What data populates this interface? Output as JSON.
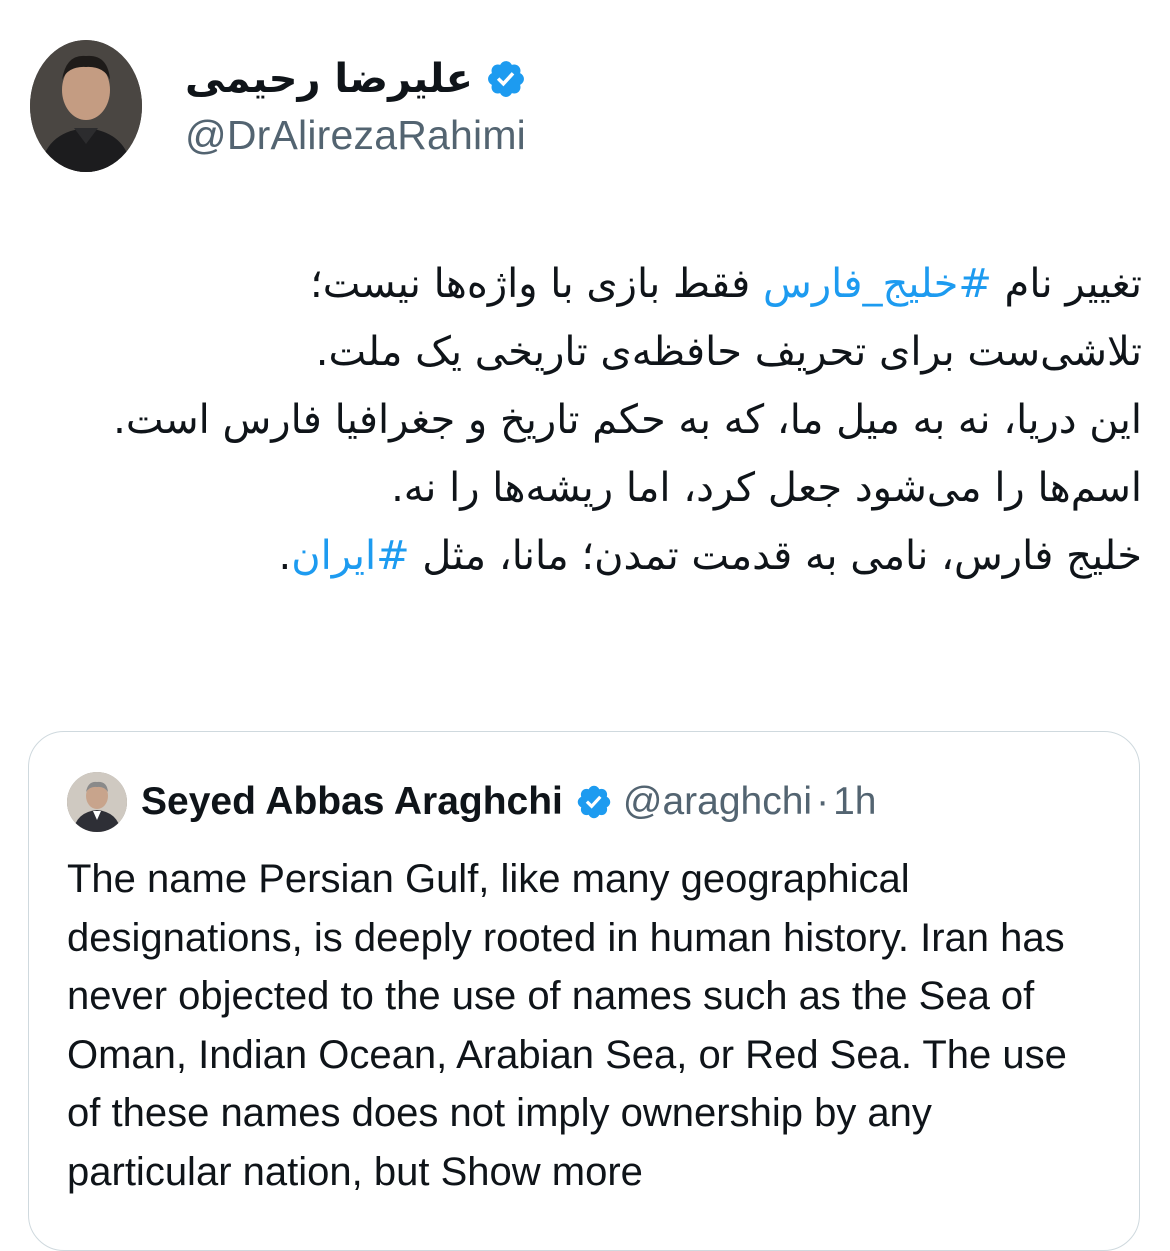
{
  "author": {
    "display_name": "علیرضا رحیمی",
    "handle": "@DrAlirezaRahimi",
    "verified_icon": "verified-badge-icon",
    "verified_color": "#1d9bf0"
  },
  "tweet": {
    "line1": {
      "pre": "تغییر نام ",
      "hashtag": "#خلیج_فارس",
      "post": " فقط بازی با واژه‌ها نیست؛"
    },
    "line2": "تلاشی‌ست برای تحریف حافظه‌ی تاریخی یک ملت.",
    "line3": "این دریا، نه به میل ما، که به حکم تاریخ و جغرافیا فارس است.",
    "line4": "اسم‌ها را می‌شود جعل کرد، اما ریشه‌ها را نه.",
    "line5": {
      "pre": "خلیج فارس، نامی به قدمت تمدن؛ مانا، مثل ",
      "hashtag": "#ایران",
      "post": "."
    },
    "hashtag_color": "#1d9bf0"
  },
  "quote": {
    "name": "Seyed Abbas Araghchi",
    "handle": "@araghchi",
    "separator": "·",
    "time": "1h",
    "text": "The name Persian Gulf, like many geographical designations, is deeply rooted in human history. Iran has never objected to the use of names such as the Sea of Oman, Indian Ocean, Arabian Sea, or Red Sea. The use of these names does not imply ownership by any particular nation, but",
    "show_more": "Show more",
    "border_color": "#cfd9de"
  }
}
